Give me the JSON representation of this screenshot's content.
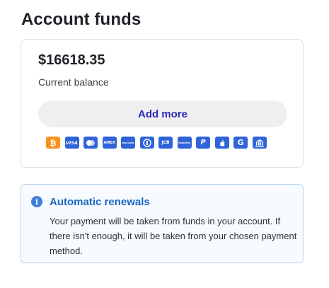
{
  "page": {
    "title": "Account funds"
  },
  "funds": {
    "balance": "$16618.35",
    "balance_label": "Current balance",
    "add_more_label": "Add more",
    "payment_methods": [
      {
        "name": "bitcoin-icon",
        "color": "#f7931a"
      },
      {
        "name": "visa-icon",
        "label": "VISA",
        "color": "#2f63d8"
      },
      {
        "name": "mastercard-icon",
        "color": "#2f63d8"
      },
      {
        "name": "amex-icon",
        "label": "AMEX",
        "color": "#2f63d8"
      },
      {
        "name": "discover-icon",
        "label": "DISCOVER",
        "color": "#2f63d8"
      },
      {
        "name": "diners-club-icon",
        "color": "#2f63d8"
      },
      {
        "name": "jcb-icon",
        "label": "JCB",
        "color": "#2f63d8"
      },
      {
        "name": "unionpay-icon",
        "label": "UnionPay",
        "color": "#2f63d8"
      },
      {
        "name": "paypal-icon",
        "label": "P",
        "color": "#2f63d8"
      },
      {
        "name": "apple-pay-icon",
        "color": "#2f63d8"
      },
      {
        "name": "google-pay-icon",
        "label": "G",
        "color": "#2f63d8"
      },
      {
        "name": "bank-icon",
        "color": "#2f63d8"
      }
    ]
  },
  "renewals": {
    "title": "Automatic renewals",
    "description": "Your payment will be taken from funds in your account. If there isn't enough, it will be taken from your chosen payment method."
  },
  "colors": {
    "accent": "#2b2bb8",
    "info_blue": "#1a66c2",
    "bitcoin": "#f7931a",
    "payment_blue": "#2f63d8"
  }
}
